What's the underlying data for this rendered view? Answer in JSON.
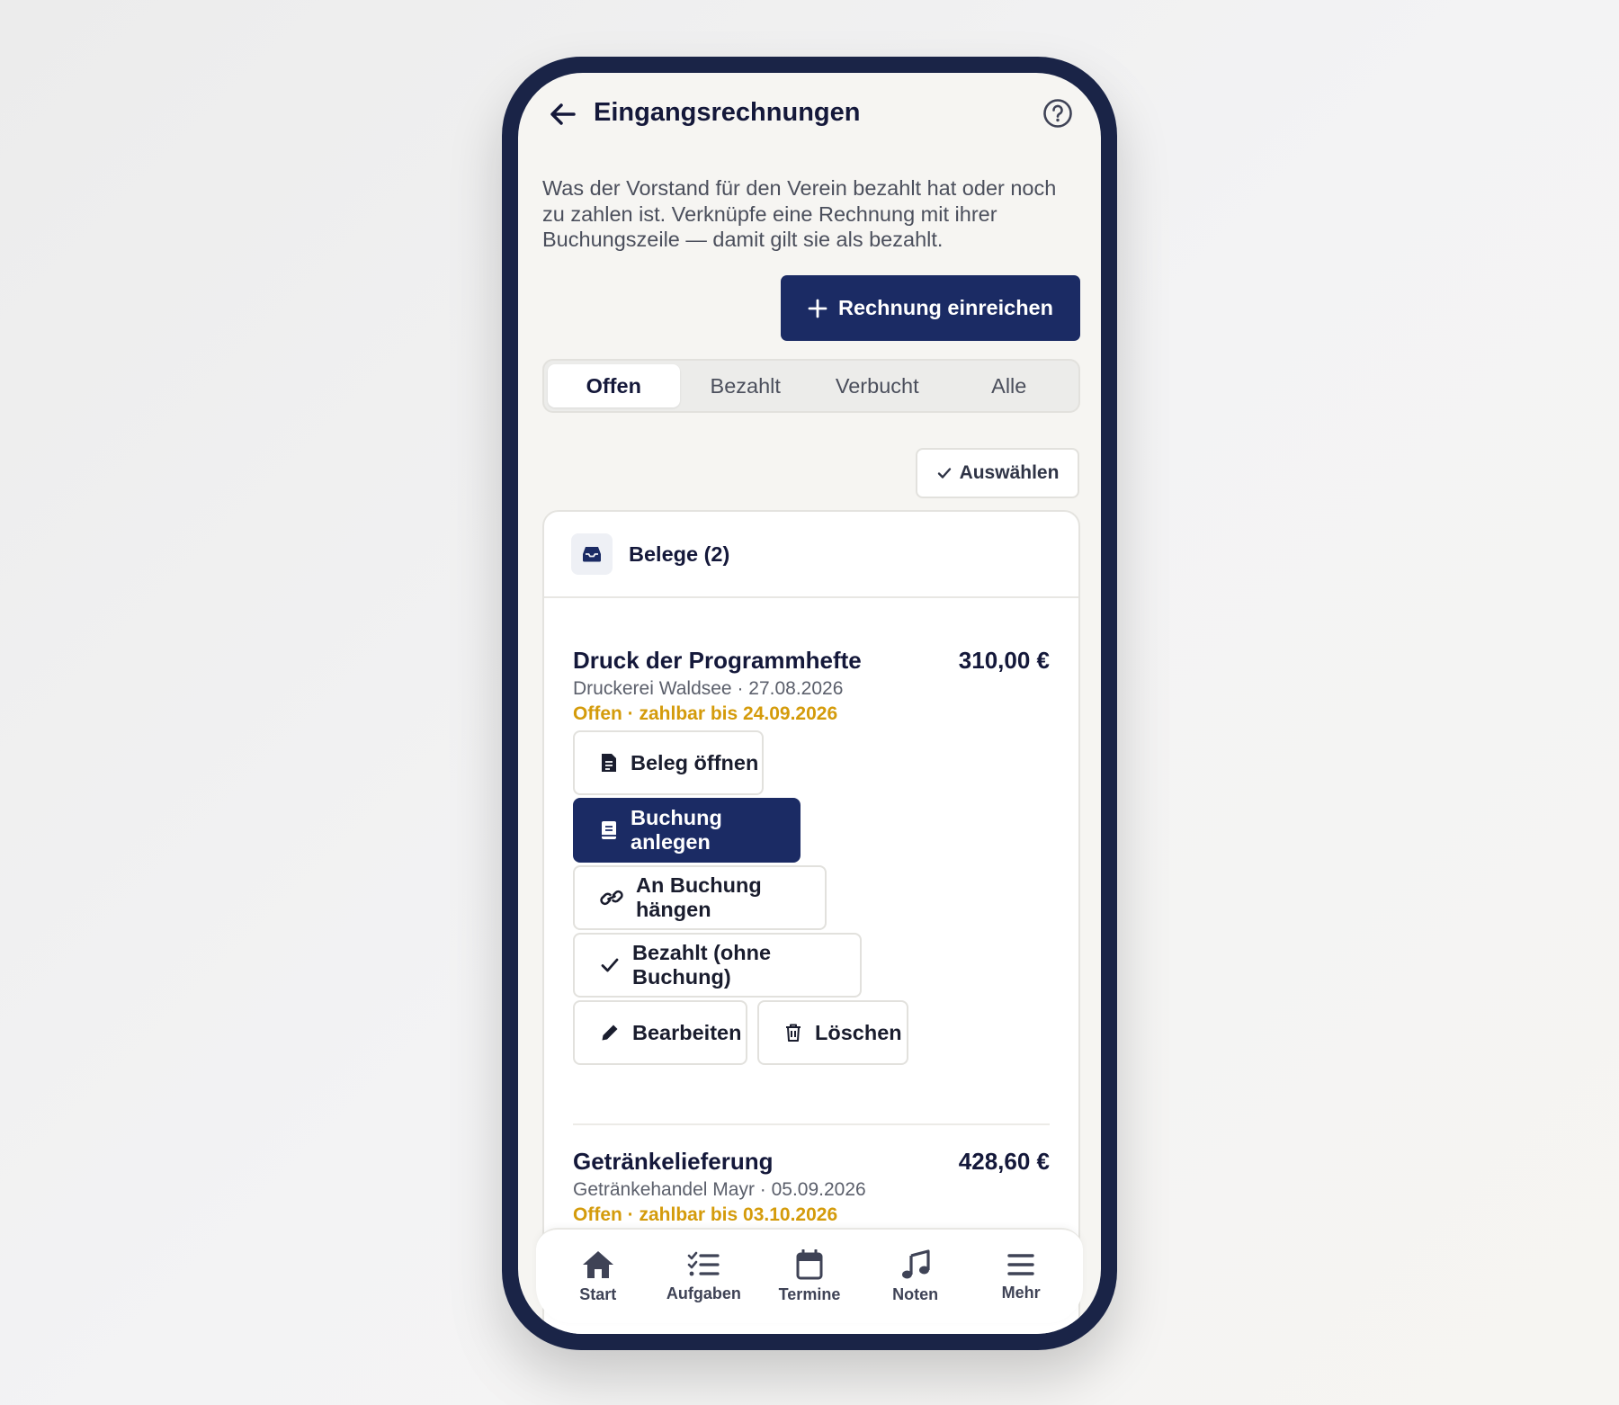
{
  "header": {
    "title": "Eingangsrechnungen"
  },
  "intro_text": "Was der Vorstand für den Verein bezahlt hat oder noch zu zahlen ist. Verknüpfe eine Rechnung mit ihrer Buchungszeile — damit gilt sie als bezahlt.",
  "submit_button": {
    "label": "Rechnung einreichen"
  },
  "tabs": [
    {
      "label": "Offen",
      "active": true
    },
    {
      "label": "Bezahlt",
      "active": false
    },
    {
      "label": "Verbucht",
      "active": false
    },
    {
      "label": "Alle",
      "active": false
    }
  ],
  "select_button": {
    "label": "Auswählen"
  },
  "card": {
    "title": "Belege (2)"
  },
  "invoices": [
    {
      "title": "Druck der Programmhefte",
      "amount": "310,00 €",
      "meta": "Druckerei Waldsee · 27.08.2026",
      "status": "Offen · zahlbar bis 24.09.2026",
      "actions": {
        "open": "Beleg öffnen",
        "create_booking": "Buchung anlegen",
        "attach": "An Buchung hängen",
        "paid": "Bezahlt (ohne Buchung)",
        "edit": "Bearbeiten",
        "delete": "Löschen"
      }
    },
    {
      "title": "Getränkelieferung",
      "amount": "428,60 €",
      "meta": "Getränkehandel Mayr · 05.09.2026",
      "status": "Offen · zahlbar bis 03.10.2026"
    }
  ],
  "nav": [
    {
      "label": "Start",
      "icon": "home-icon"
    },
    {
      "label": "Aufgaben",
      "icon": "tasks-icon"
    },
    {
      "label": "Termine",
      "icon": "calendar-icon"
    },
    {
      "label": "Noten",
      "icon": "music-icon"
    },
    {
      "label": "Mehr",
      "icon": "menu-icon"
    }
  ],
  "colors": {
    "primary": "#1b2b64",
    "status_open": "#d49b0b",
    "frame": "#1a2447",
    "background": "#f6f5f2"
  }
}
